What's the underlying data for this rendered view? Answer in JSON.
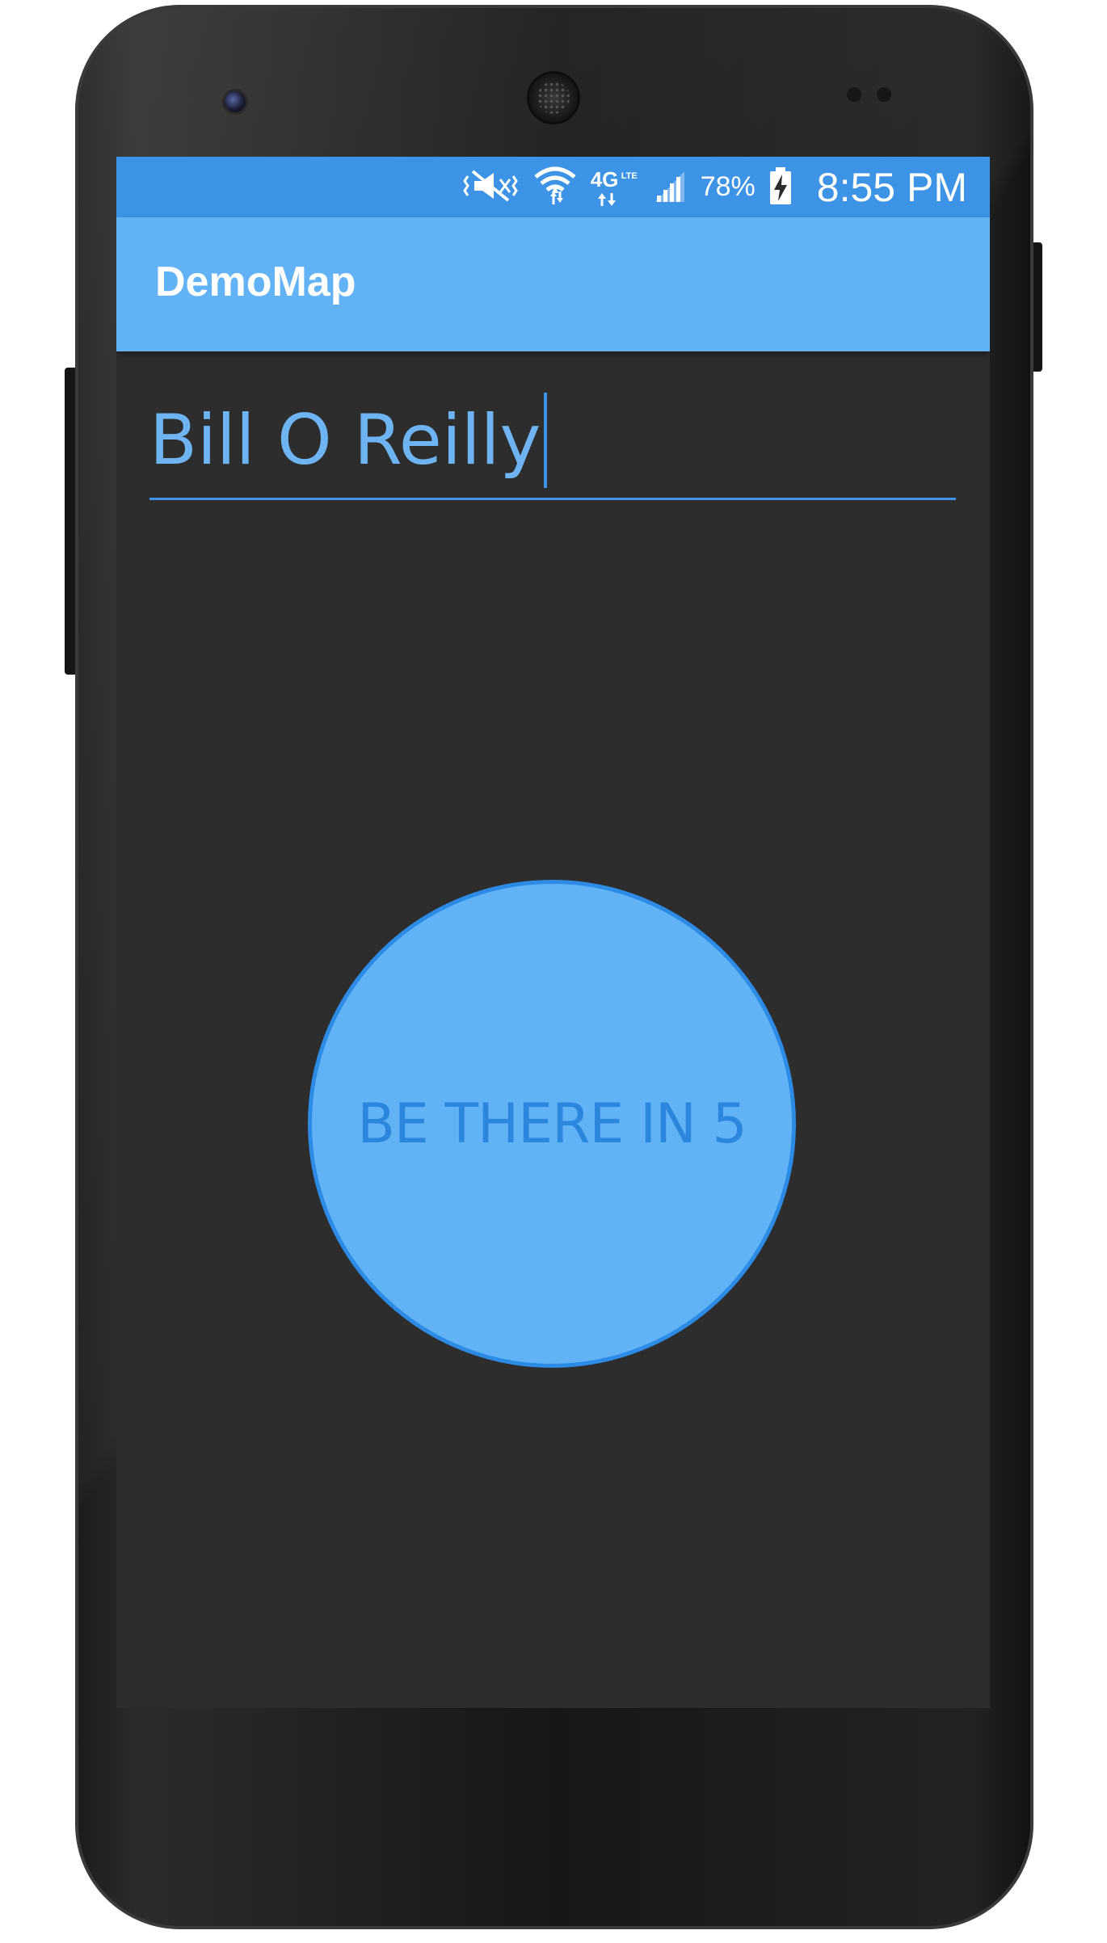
{
  "status_bar": {
    "icons": [
      "mute-vibrate-icon",
      "wifi-icon",
      "4g-lte-icon",
      "cell-signal-icon",
      "battery-charging-icon"
    ],
    "network_label": "4G",
    "network_sub": "LTE",
    "battery_percent": "78%",
    "time": "8:55 PM"
  },
  "app_bar": {
    "title": "DemoMap"
  },
  "name_input": {
    "value": "Bill O Reilly"
  },
  "main": {
    "action_button_label": "BE THERE IN 5"
  },
  "colors": {
    "status_bar": "#3d93e6",
    "app_bar": "#62b3f5",
    "screen_background": "#2d2d2d",
    "accent": "#3f94ea",
    "button_fill": "#62b3f5",
    "button_text": "#2d86de"
  }
}
